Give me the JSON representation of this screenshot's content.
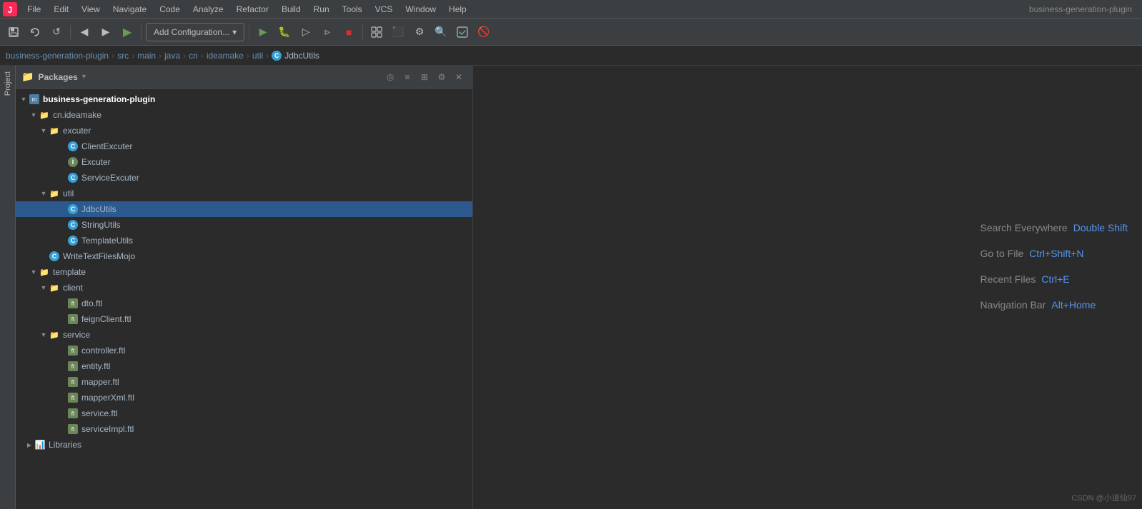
{
  "app": {
    "title": "business-generation-plugin",
    "logo_char": "🔴"
  },
  "menu": {
    "items": [
      "File",
      "Edit",
      "View",
      "Navigate",
      "Code",
      "Analyze",
      "Refactor",
      "Build",
      "Run",
      "Tools",
      "VCS",
      "Window",
      "Help"
    ]
  },
  "toolbar": {
    "add_config_label": "Add Configuration...",
    "add_config_arrow": "▾"
  },
  "breadcrumb": {
    "items": [
      "business-generation-plugin",
      "src",
      "main",
      "java",
      "cn",
      "ideamake",
      "util"
    ],
    "current_icon": "C",
    "current": "JdbcUtils"
  },
  "panel": {
    "title": "Packages",
    "title_arrow": "▾"
  },
  "tree": {
    "root": {
      "name": "business-generation-plugin",
      "icon_type": "module",
      "children": [
        {
          "name": "cn.ideamake",
          "icon_type": "folder",
          "indent": 1,
          "children": [
            {
              "name": "excuter",
              "icon_type": "folder",
              "indent": 2,
              "children": [
                {
                  "name": "ClientExcuter",
                  "icon_type": "class_blue",
                  "indent": 3
                },
                {
                  "name": "Excuter",
                  "icon_type": "class_green",
                  "indent": 3
                },
                {
                  "name": "ServiceExcuter",
                  "icon_type": "class_blue",
                  "indent": 3
                }
              ]
            },
            {
              "name": "util",
              "icon_type": "folder",
              "indent": 2,
              "children": [
                {
                  "name": "JdbcUtils",
                  "icon_type": "class_blue",
                  "indent": 3,
                  "selected": true
                },
                {
                  "name": "StringUtils",
                  "icon_type": "class_blue",
                  "indent": 3
                },
                {
                  "name": "TemplateUtils",
                  "icon_type": "class_blue",
                  "indent": 3
                }
              ]
            }
          ]
        },
        {
          "name": "WriteTextFilesMojo",
          "icon_type": "class_blue",
          "indent": 2
        }
      ]
    },
    "template_folder": {
      "name": "template",
      "icon_type": "folder",
      "indent": 1,
      "children": [
        {
          "name": "client",
          "icon_type": "folder",
          "indent": 2,
          "children": [
            {
              "name": "dto.ftl",
              "icon_type": "template",
              "indent": 3
            },
            {
              "name": "feignClient.ftl",
              "icon_type": "template",
              "indent": 3
            }
          ]
        },
        {
          "name": "service",
          "icon_type": "folder",
          "indent": 2,
          "children": [
            {
              "name": "controller.ftl",
              "icon_type": "template",
              "indent": 3
            },
            {
              "name": "entity.ftl",
              "icon_type": "template",
              "indent": 3
            },
            {
              "name": "mapper.ftl",
              "icon_type": "template",
              "indent": 3
            },
            {
              "name": "mapperXml.ftl",
              "icon_type": "template",
              "indent": 3
            },
            {
              "name": "service.ftl",
              "icon_type": "template",
              "indent": 3
            },
            {
              "name": "serviceImpl.ftl",
              "icon_type": "template",
              "indent": 3
            }
          ]
        }
      ]
    },
    "libraries": "Libraries"
  },
  "shortcuts": [
    {
      "label": "Search Everywhere",
      "key": "Double Shift"
    },
    {
      "label": "Go to File",
      "key": "Ctrl+Shift+N"
    },
    {
      "label": "Recent Files",
      "key": "Ctrl+E"
    },
    {
      "label": "Navigation Bar",
      "key": "Alt+Home"
    }
  ],
  "watermark": "CSDN @小道仙97"
}
